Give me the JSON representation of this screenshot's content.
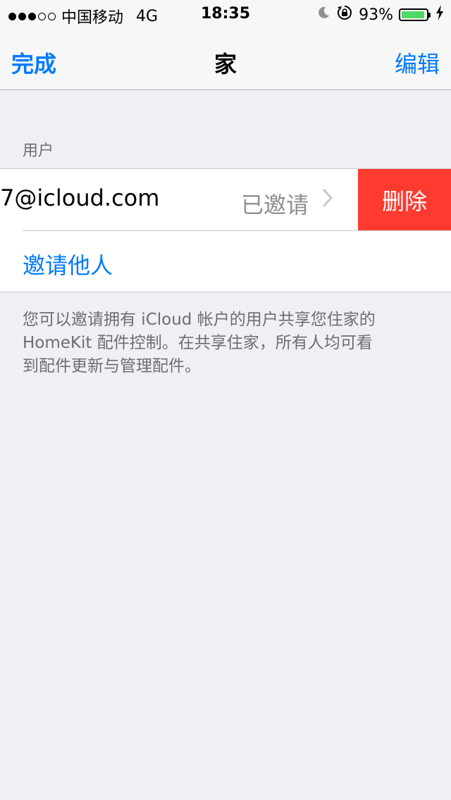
{
  "status_bar": {
    "signal_filled": 3,
    "signal_empty": 2,
    "carrier": "中国移动",
    "network": "4G",
    "time": "18:35",
    "battery_text": "93%",
    "battery_level": 0.93,
    "battery_color": "#4cd964"
  },
  "nav": {
    "left_label": "完成",
    "title": "家",
    "right_label": "编辑",
    "tint_color": "#007aff"
  },
  "users_section": {
    "header": "用户",
    "user_row": {
      "email_visible": "7@icloud.com",
      "status": "已邀请",
      "delete_label": "删除",
      "delete_color": "#ff3b30"
    },
    "invite_label": "邀请他人",
    "footer_lines": [
      "您可以邀请拥有 iCloud 帐户的用户共享您住家的",
      "HomeKit 配件控制。在共享住家，所有人均可看",
      "到配件更新与管理配件。"
    ]
  },
  "icons": {
    "moon": "moon-icon",
    "rotation_lock": "rotation-lock-icon",
    "charging": "charging-bolt-icon",
    "chevron": "chevron-right-icon"
  }
}
